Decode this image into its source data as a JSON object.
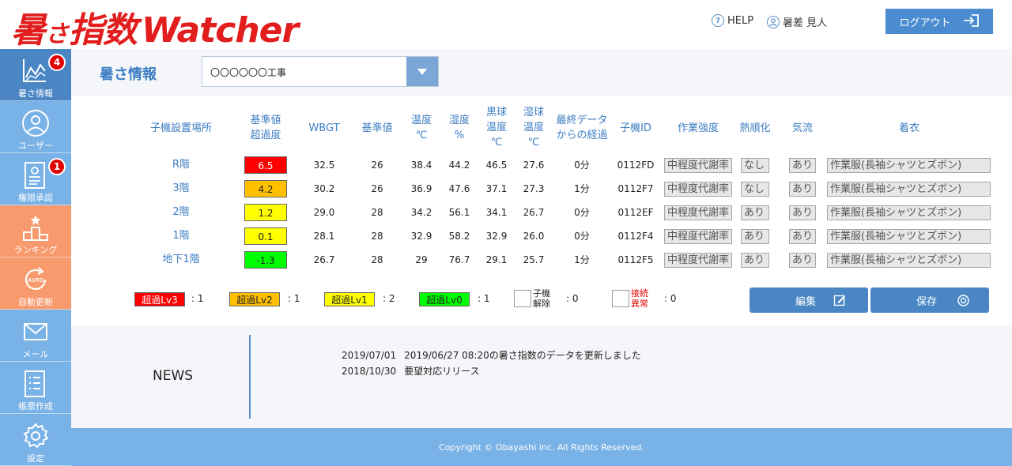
{
  "header": {
    "logo_part1": "暑",
    "logo_part2": "さ",
    "logo_part3": "指数",
    "logo_part4": "Watcher",
    "help": "HELP",
    "user": "暑差 見人",
    "logout": "ログアウト"
  },
  "sidebar": {
    "items": [
      {
        "label": "暑さ情報",
        "badge": "4"
      },
      {
        "label": "ユーザー"
      },
      {
        "label": "権限承認",
        "badge": "1"
      },
      {
        "label": "ランキング"
      },
      {
        "label": "自動更新",
        "icon_text": "AUTO"
      },
      {
        "label": "メール"
      },
      {
        "label": "帳票作成"
      },
      {
        "label": "設定"
      }
    ]
  },
  "main": {
    "title": "暑さ情報",
    "site_select": "〇〇〇〇〇〇工事"
  },
  "table": {
    "headers": {
      "location": "子機設置場所",
      "excess_1": "基準値",
      "excess_2": "超過度",
      "wbgt": "WBGT",
      "ref": "基準値",
      "temp_1": "温度",
      "temp_2": "℃",
      "hum_1": "湿度",
      "hum_2": "%",
      "black_1": "黒球",
      "black_2": "温度",
      "black_3": "℃",
      "wet_1": "湿球",
      "wet_2": "温度",
      "wet_3": "℃",
      "last_1": "最終データ",
      "last_2": "からの経過",
      "id": "子機ID",
      "work": "作業強度",
      "accl": "熱順化",
      "air": "気流",
      "cloth": "着衣"
    },
    "rows": [
      {
        "location": "R階",
        "excess": "6.5",
        "level": "lv3",
        "wbgt": "32.5",
        "ref": "26",
        "temp": "38.4",
        "hum": "44.2",
        "black": "46.5",
        "wet": "27.6",
        "elapsed": "0分",
        "id": "0112FD",
        "work": "中程度代謝率",
        "accl": "なし",
        "air": "あり",
        "cloth": "作業服(長袖シャツとズボン)"
      },
      {
        "location": "3階",
        "excess": "4.2",
        "level": "lv2",
        "wbgt": "30.2",
        "ref": "26",
        "temp": "36.9",
        "hum": "47.6",
        "black": "37.1",
        "wet": "27.3",
        "elapsed": "1分",
        "id": "0112F7",
        "work": "中程度代謝率",
        "accl": "なし",
        "air": "あり",
        "cloth": "作業服(長袖シャツとズボン)"
      },
      {
        "location": "2階",
        "excess": "1.2",
        "level": "lv1",
        "wbgt": "29.0",
        "ref": "28",
        "temp": "34.2",
        "hum": "56.1",
        "black": "34.1",
        "wet": "26.7",
        "elapsed": "0分",
        "id": "0112EF",
        "work": "中程度代謝率",
        "accl": "あり",
        "air": "あり",
        "cloth": "作業服(長袖シャツとズボン)"
      },
      {
        "location": "1階",
        "excess": "0.1",
        "level": "lv1",
        "wbgt": "28.1",
        "ref": "28",
        "temp": "32.9",
        "hum": "58.2",
        "black": "32.9",
        "wet": "26.0",
        "elapsed": "0分",
        "id": "0112F4",
        "work": "中程度代謝率",
        "accl": "あり",
        "air": "あり",
        "cloth": "作業服(長袖シャツとズボン)"
      },
      {
        "location": "地下1階",
        "excess": "-1.3",
        "level": "lv0",
        "wbgt": "26.7",
        "ref": "28",
        "temp": "29",
        "hum": "76.7",
        "black": "29.1",
        "wet": "25.7",
        "elapsed": "1分",
        "id": "0112F5",
        "work": "中程度代謝率",
        "accl": "あり",
        "air": "あり",
        "cloth": "作業服(長袖シャツとズボン)"
      }
    ]
  },
  "colors": {
    "lv3": "#ff0000",
    "lv2": "#ffc000",
    "lv1": "#ffff00",
    "lv0": "#00ff00"
  },
  "legend": {
    "lv3": {
      "label": "超過Lv3",
      "count": ": 1"
    },
    "lv2": {
      "label": "超過Lv2",
      "count": ": 1"
    },
    "lv1": {
      "label": "超過Lv1",
      "count": ": 2"
    },
    "lv0": {
      "label": "超過Lv0",
      "count": ": 1"
    },
    "off": {
      "label_1": "子機",
      "label_2": "解除",
      "count": ": 0"
    },
    "err": {
      "label_1": "接続",
      "label_2": "異常",
      "count": ": 0"
    }
  },
  "actions": {
    "edit": "編集",
    "save": "保存"
  },
  "news": {
    "title": "NEWS",
    "items": [
      {
        "date": "2019/07/01",
        "text": "2019/06/27 08:20の暑さ指数のデータを更新しました"
      },
      {
        "date": "2018/10/30",
        "text": "要望対応リリース"
      }
    ]
  },
  "footer": {
    "copyright": "Copyright © Obayashi inc. All Rights Reserved."
  }
}
